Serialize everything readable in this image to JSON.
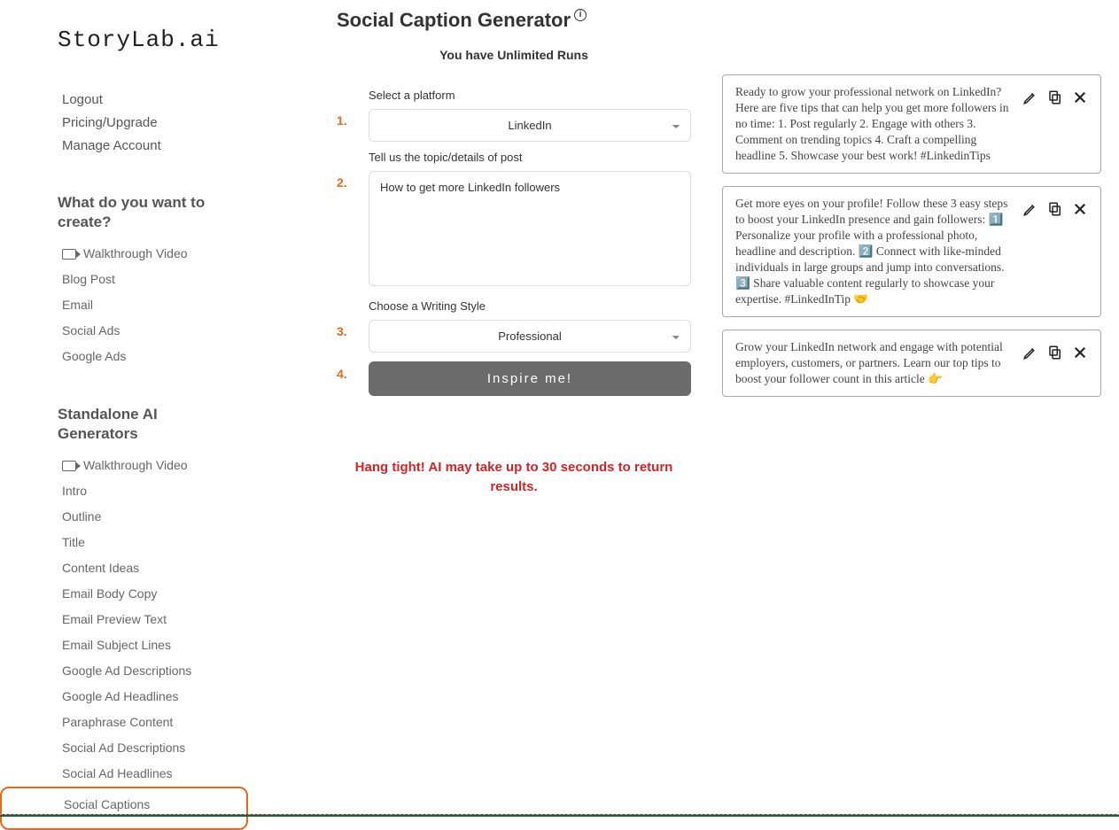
{
  "logo": "StoryLab.ai",
  "account": {
    "logout": "Logout",
    "pricing": "Pricing/Upgrade",
    "manage": "Manage Account"
  },
  "sections": {
    "create_head": "What do you want to create?",
    "create_items": [
      "Walkthrough Video",
      "Blog Post",
      "Email",
      "Social Ads",
      "Google Ads"
    ],
    "standalone_head": "Standalone AI Generators",
    "standalone_items": [
      "Walkthrough Video",
      "Intro",
      "Outline",
      "Title",
      "Content Ideas",
      "Email Body Copy",
      "Email Preview Text",
      "Email Subject Lines",
      "Google Ad Descriptions",
      "Google Ad Headlines",
      "Paraphrase Content",
      "Social Ad Descriptions",
      "Social Ad Headlines",
      "Social Captions"
    ]
  },
  "page": {
    "title": "Social Caption Generator",
    "runs": "You have Unlimited Runs"
  },
  "form": {
    "step1_label": "Select a platform",
    "step1_value": "LinkedIn",
    "step2_label": "Tell us the topic/details of post",
    "step2_value": "How to get more LinkedIn followers",
    "step3_label": "Choose a Writing Style",
    "step3_value": "Professional",
    "button": "Inspire me!",
    "steps": [
      "1.",
      "2.",
      "3.",
      "4."
    ]
  },
  "wait_message": "Hang tight! AI may take up to 30 seconds to return results.",
  "results": [
    "Ready to grow your professional network on LinkedIn? Here are five tips that can help you get more followers in no time: 1. Post regularly 2. Engage with others 3. Comment on trending topics 4. Craft a compelling headline 5. Showcase your best work! #LinkedinTips",
    "Get more eyes on your profile! Follow these 3 easy steps to boost your LinkedIn presence and gain followers: 1️⃣ Personalize your profile with a professional photo, headline and description. 2️⃣ Connect with like-minded individuals in large groups and jump into conversations. 3️⃣ Share valuable content regularly to showcase your expertise. #LinkedInTip 🤝",
    "Grow your LinkedIn network and engage with potential employers, customers, or partners. Learn our top tips to boost your follower count in this article 👉"
  ]
}
